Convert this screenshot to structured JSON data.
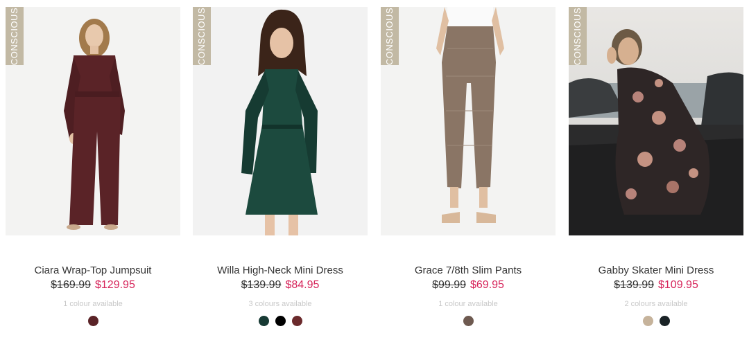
{
  "products": [
    {
      "badge": "CONSCIOUS",
      "name": "Ciara Wrap-Top Jumpsuit",
      "price_was": "$169.99",
      "price_now": "$129.95",
      "colours_text": "1 colour available",
      "swatches": [
        "#5a2327"
      ]
    },
    {
      "badge": "CONSCIOUS",
      "name": "Willa High-Neck Mini Dress",
      "price_was": "$139.99",
      "price_now": "$84.95",
      "colours_text": "3 colours available",
      "swatches": [
        "#173a34",
        "#000000",
        "#6b2a2c"
      ]
    },
    {
      "badge": "CONSCIOUS",
      "name": "Grace 7/8th Slim Pants",
      "price_was": "$99.99",
      "price_now": "$69.95",
      "colours_text": "1 colour available",
      "swatches": [
        "#6e5a50"
      ]
    },
    {
      "badge": "CONSCIOUS",
      "name": "Gabby Skater Mini Dress",
      "price_was": "$139.99",
      "price_now": "$109.95",
      "colours_text": "2 colours available",
      "swatches": [
        "#c6b39b",
        "#1a2326"
      ]
    }
  ],
  "colors": {
    "badge": "#c2b9a4",
    "sale_price": "#d6245a",
    "text": "#333333",
    "muted": "#c8c8c8"
  }
}
